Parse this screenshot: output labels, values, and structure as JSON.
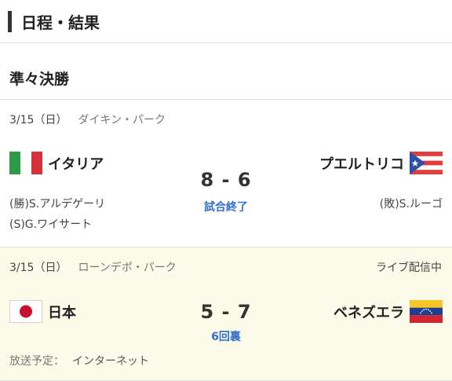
{
  "header": {
    "title": "日程・結果"
  },
  "round": {
    "label": "準々決勝"
  },
  "games": [
    {
      "date": "3/15（日）",
      "venue": "ダイキン・パーク",
      "home": {
        "name": "イタリア",
        "flag": "italy-flag-icon"
      },
      "away": {
        "name": "プエルトリコ",
        "flag": "puerto-rico-flag-icon"
      },
      "score": "8 - 6",
      "status": "試合終了",
      "win_pitcher": "(勝)S.アルデゲーリ",
      "save_pitcher": "(S)G.ワイサート",
      "lose_pitcher": "(敗)S.ルーゴ"
    },
    {
      "date": "3/15（日）",
      "venue": "ローンデポ・パーク",
      "live": "ライブ配信中",
      "home": {
        "name": "日本",
        "flag": "japan-flag-icon"
      },
      "away": {
        "name": "ベネズエラ",
        "flag": "venezuela-flag-icon"
      },
      "score": "5 - 7",
      "status": "6回裏",
      "broadcast_label": "放送予定：",
      "broadcast_value": "インターネット"
    }
  ],
  "colors": {
    "status": "#2f6fc9",
    "live_bg": "#fcfbea"
  }
}
